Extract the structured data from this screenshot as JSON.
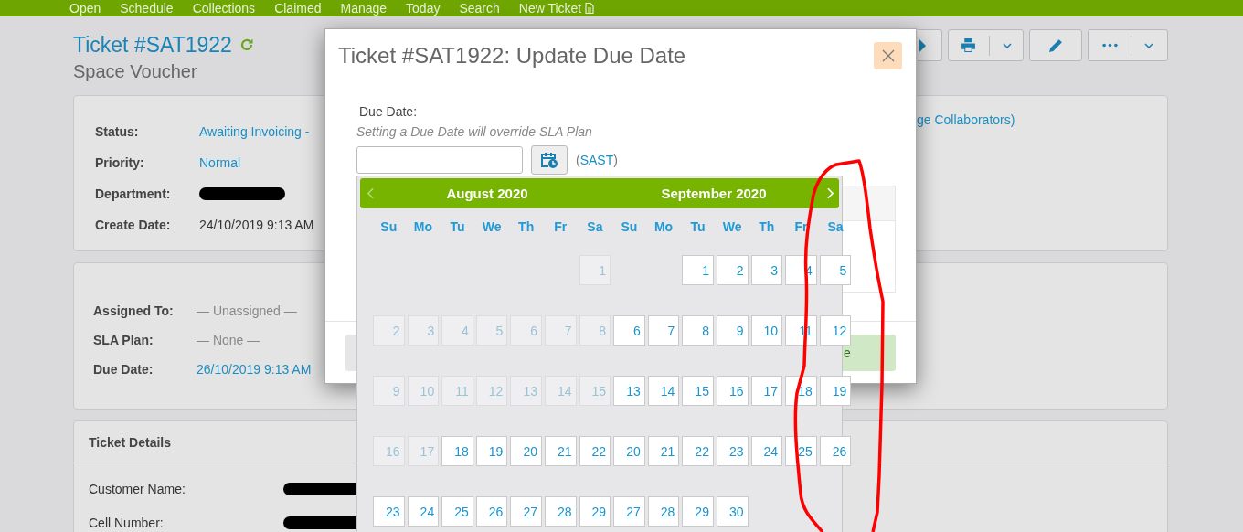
{
  "nav": [
    {
      "label": "Open",
      "kind": "link"
    },
    {
      "label": "Schedule",
      "kind": "link"
    },
    {
      "label": "Collections",
      "kind": "link"
    },
    {
      "label": "Claimed",
      "kind": "link"
    },
    {
      "label": "Manage",
      "kind": "link"
    },
    {
      "label": "Today",
      "kind": "link"
    },
    {
      "label": "Search",
      "kind": "link"
    },
    {
      "label": "New Ticket",
      "kind": "link-with-icon"
    }
  ],
  "ticket": {
    "title": "Ticket #SAT1922",
    "subtitle": "Space Voucher"
  },
  "toolbar": [
    {
      "kind": "arrow"
    },
    {
      "kind": "print"
    },
    {
      "kind": "edit"
    },
    {
      "kind": "more"
    }
  ],
  "status_card": {
    "fields": [
      {
        "label": "Status:",
        "value": "Awaiting Invoicing -",
        "kind": "link"
      },
      {
        "label": "Priority:",
        "value": "Normal",
        "kind": "link"
      },
      {
        "label": "Department:",
        "kind": "redacted"
      },
      {
        "label": "Create Date:",
        "value": "24/10/2019 9:13 AM",
        "kind": "text"
      }
    ],
    "collaborators_link": "ge Collaborators)"
  },
  "assignment_card": {
    "fields": [
      {
        "label": "Assigned To:",
        "value": "— Unassigned —",
        "kind": "muted"
      },
      {
        "label": "SLA Plan:",
        "value": "— None —",
        "kind": "muted"
      },
      {
        "label": "Due Date:",
        "value": "26/10/2019 9:13 AM",
        "kind": "link"
      }
    ]
  },
  "details_card": {
    "title": "Ticket Details",
    "fields": [
      {
        "label": "Customer Name:",
        "kind": "redacted"
      },
      {
        "label": "Cell Number:",
        "kind": "redacted"
      }
    ]
  },
  "modal": {
    "title": "Ticket #SAT1922: Update Due Date",
    "field_label": "Due Date:",
    "hint": "Setting a Due Date will override SLA Plan",
    "timezone_prefix": "(",
    "timezone": "SAST",
    "timezone_suffix": ")",
    "confirm_button": "e"
  },
  "calendar": {
    "prev": {
      "disabled": true
    },
    "next": {
      "disabled": false
    },
    "months": [
      {
        "title": "August 2020",
        "weekdays": [
          "Su",
          "Mo",
          "Tu",
          "We",
          "Th",
          "Fr",
          "Sa"
        ],
        "weeks": [
          [
            {
              "kind": "empty"
            },
            {
              "kind": "empty"
            },
            {
              "kind": "empty"
            },
            {
              "kind": "empty"
            },
            {
              "kind": "empty"
            },
            {
              "kind": "empty"
            },
            {
              "kind": "day",
              "day": "1",
              "disabled": true
            }
          ],
          [
            {
              "kind": "day",
              "day": "2",
              "disabled": true
            },
            {
              "kind": "day",
              "day": "3",
              "disabled": true
            },
            {
              "kind": "day",
              "day": "4",
              "disabled": true
            },
            {
              "kind": "day",
              "day": "5",
              "disabled": true
            },
            {
              "kind": "day",
              "day": "6",
              "disabled": true
            },
            {
              "kind": "day",
              "day": "7",
              "disabled": true
            },
            {
              "kind": "day",
              "day": "8",
              "disabled": true
            }
          ],
          [
            {
              "kind": "day",
              "day": "9",
              "disabled": true
            },
            {
              "kind": "day",
              "day": "10",
              "disabled": true
            },
            {
              "kind": "day",
              "day": "11",
              "disabled": true
            },
            {
              "kind": "day",
              "day": "12",
              "disabled": true
            },
            {
              "kind": "day",
              "day": "13",
              "disabled": true
            },
            {
              "kind": "day",
              "day": "14",
              "disabled": true
            },
            {
              "kind": "day",
              "day": "15",
              "disabled": true
            }
          ],
          [
            {
              "kind": "day",
              "day": "16",
              "disabled": true
            },
            {
              "kind": "day",
              "day": "17",
              "disabled": true
            },
            {
              "kind": "day",
              "day": "18",
              "disabled": false
            },
            {
              "kind": "day",
              "day": "19",
              "disabled": false
            },
            {
              "kind": "day",
              "day": "20",
              "disabled": false
            },
            {
              "kind": "day",
              "day": "21",
              "disabled": false
            },
            {
              "kind": "day",
              "day": "22",
              "disabled": false
            }
          ],
          [
            {
              "kind": "day",
              "day": "23",
              "disabled": false
            },
            {
              "kind": "day",
              "day": "24",
              "disabled": false
            },
            {
              "kind": "day",
              "day": "25",
              "disabled": false
            },
            {
              "kind": "day",
              "day": "26",
              "disabled": false
            },
            {
              "kind": "day",
              "day": "27",
              "disabled": false
            },
            {
              "kind": "day",
              "day": "28",
              "disabled": false
            },
            {
              "kind": "day",
              "day": "29",
              "disabled": false
            }
          ]
        ]
      },
      {
        "title": "September 2020",
        "weekdays": [
          "Su",
          "Mo",
          "Tu",
          "We",
          "Th",
          "Fr",
          "Sa"
        ],
        "weeks": [
          [
            {
              "kind": "empty"
            },
            {
              "kind": "empty"
            },
            {
              "kind": "day",
              "day": "1",
              "disabled": false
            },
            {
              "kind": "day",
              "day": "2",
              "disabled": false
            },
            {
              "kind": "day",
              "day": "3",
              "disabled": false
            },
            {
              "kind": "day",
              "day": "4",
              "disabled": false
            },
            {
              "kind": "day",
              "day": "5",
              "disabled": false
            }
          ],
          [
            {
              "kind": "day",
              "day": "6",
              "disabled": false
            },
            {
              "kind": "day",
              "day": "7",
              "disabled": false
            },
            {
              "kind": "day",
              "day": "8",
              "disabled": false
            },
            {
              "kind": "day",
              "day": "9",
              "disabled": false
            },
            {
              "kind": "day",
              "day": "10",
              "disabled": false
            },
            {
              "kind": "day",
              "day": "11",
              "disabled": false
            },
            {
              "kind": "day",
              "day": "12",
              "disabled": false
            }
          ],
          [
            {
              "kind": "day",
              "day": "13",
              "disabled": false
            },
            {
              "kind": "day",
              "day": "14",
              "disabled": false
            },
            {
              "kind": "day",
              "day": "15",
              "disabled": false
            },
            {
              "kind": "day",
              "day": "16",
              "disabled": false
            },
            {
              "kind": "day",
              "day": "17",
              "disabled": false
            },
            {
              "kind": "day",
              "day": "18",
              "disabled": false
            },
            {
              "kind": "day",
              "day": "19",
              "disabled": false
            }
          ],
          [
            {
              "kind": "day",
              "day": "20",
              "disabled": false
            },
            {
              "kind": "day",
              "day": "21",
              "disabled": false
            },
            {
              "kind": "day",
              "day": "22",
              "disabled": false
            },
            {
              "kind": "day",
              "day": "23",
              "disabled": false
            },
            {
              "kind": "day",
              "day": "24",
              "disabled": false
            },
            {
              "kind": "day",
              "day": "25",
              "disabled": false
            },
            {
              "kind": "day",
              "day": "26",
              "disabled": false
            }
          ],
          [
            {
              "kind": "day",
              "day": "27",
              "disabled": false
            },
            {
              "kind": "day",
              "day": "28",
              "disabled": false
            },
            {
              "kind": "day",
              "day": "29",
              "disabled": false
            },
            {
              "kind": "day",
              "day": "30",
              "disabled": false
            },
            {
              "kind": "empty"
            },
            {
              "kind": "empty"
            },
            {
              "kind": "empty"
            }
          ]
        ]
      }
    ]
  }
}
